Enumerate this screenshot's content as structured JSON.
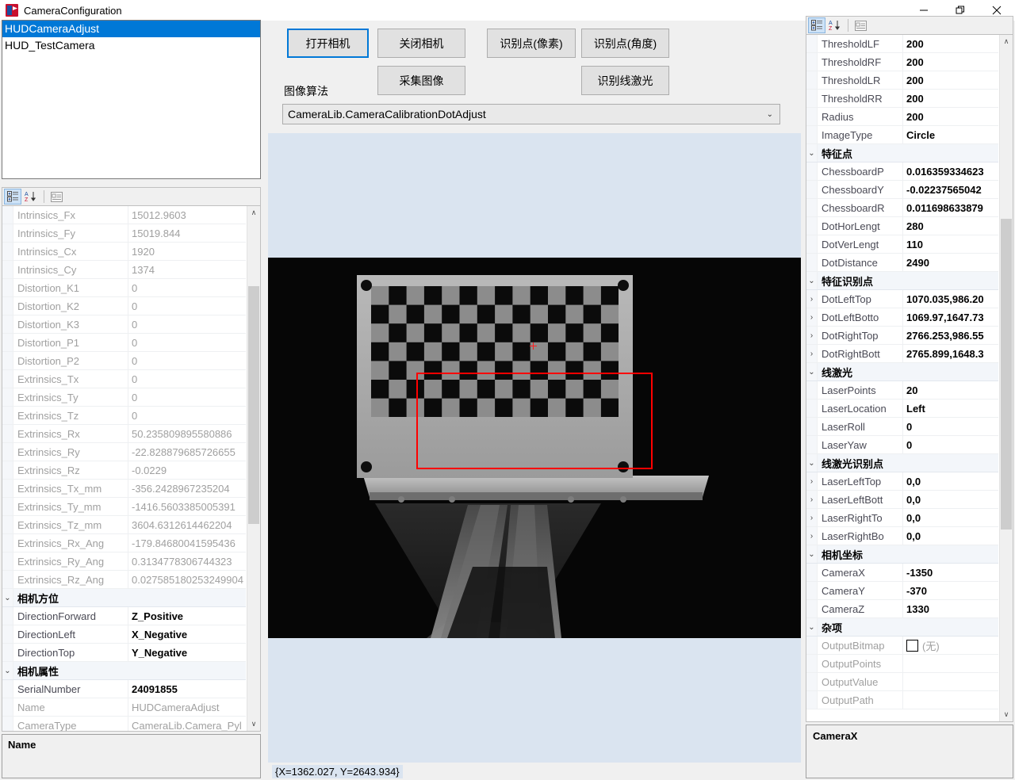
{
  "window": {
    "title": "CameraConfiguration",
    "icon": "app-icon",
    "minimize": "─",
    "maximize": "❐",
    "close": "✕"
  },
  "camera_list": {
    "items": [
      {
        "label": "HUDCameraAdjust",
        "selected": true
      },
      {
        "label": "HUD_TestCamera",
        "selected": false
      }
    ]
  },
  "toolbar": {
    "categorized_icon": "categorized-view-icon",
    "alphabetical_icon": "alphabetical-sort-icon",
    "property_pages_icon": "property-pages-icon"
  },
  "buttons": {
    "open_camera": "打开相机",
    "close_camera": "关闭相机",
    "detect_point_pixel": "识别点(像素)",
    "detect_point_angle": "识别点(角度)",
    "capture_image": "采集图像",
    "detect_line_laser": "识别线激光"
  },
  "algorithm": {
    "label": "图像算法",
    "selected": "CameraLib.CameraCalibrationDotAdjust",
    "arrow": "⌄"
  },
  "statusbar": {
    "coordinates": "{X=1362.027, Y=2643.934}"
  },
  "left_panel": {
    "description_title": "Name",
    "rows": [
      {
        "name": "Intrinsics_Fx",
        "value": "15012.9603",
        "style": "dim"
      },
      {
        "name": "Intrinsics_Fy",
        "value": "15019.844",
        "style": "dim"
      },
      {
        "name": "Intrinsics_Cx",
        "value": "1920",
        "style": "dim"
      },
      {
        "name": "Intrinsics_Cy",
        "value": "1374",
        "style": "dim"
      },
      {
        "name": "Distortion_K1",
        "value": "0",
        "style": "dim"
      },
      {
        "name": "Distortion_K2",
        "value": "0",
        "style": "dim"
      },
      {
        "name": "Distortion_K3",
        "value": "0",
        "style": "dim"
      },
      {
        "name": "Distortion_P1",
        "value": "0",
        "style": "dim"
      },
      {
        "name": "Distortion_P2",
        "value": "0",
        "style": "dim"
      },
      {
        "name": "Extrinsics_Tx",
        "value": "0",
        "style": "dim"
      },
      {
        "name": "Extrinsics_Ty",
        "value": "0",
        "style": "dim"
      },
      {
        "name": "Extrinsics_Tz",
        "value": "0",
        "style": "dim"
      },
      {
        "name": "Extrinsics_Rx",
        "value": "50.235809895580886",
        "style": "dim"
      },
      {
        "name": "Extrinsics_Ry",
        "value": "-22.828879685726655",
        "style": "dim"
      },
      {
        "name": "Extrinsics_Rz",
        "value": "-0.0229",
        "style": "dim"
      },
      {
        "name": "Extrinsics_Tx_mm",
        "value": "-356.2428967235204",
        "style": "dim"
      },
      {
        "name": "Extrinsics_Ty_mm",
        "value": "-1416.5603385005391",
        "style": "dim"
      },
      {
        "name": "Extrinsics_Tz_mm",
        "value": "3604.6312614462204",
        "style": "dim"
      },
      {
        "name": "Extrinsics_Rx_Ang",
        "value": "-179.84680041595436",
        "style": "dim"
      },
      {
        "name": "Extrinsics_Ry_Ang",
        "value": "0.3134778306744323",
        "style": "dim"
      },
      {
        "name": "Extrinsics_Rz_Ang",
        "value": "0.027585180253249904",
        "style": "dim"
      },
      {
        "name": "相机方位",
        "value": "",
        "style": "cat",
        "expander": "⌄"
      },
      {
        "name": "DirectionForward",
        "value": "Z_Positive",
        "style": "bold"
      },
      {
        "name": "DirectionLeft",
        "value": "X_Negative",
        "style": "bold"
      },
      {
        "name": "DirectionTop",
        "value": "Y_Negative",
        "style": "bold"
      },
      {
        "name": "相机属性",
        "value": "",
        "style": "cat",
        "expander": "⌄"
      },
      {
        "name": "SerialNumber",
        "value": "24091855",
        "style": "bold"
      },
      {
        "name": "Name",
        "value": "HUDCameraAdjust",
        "style": "dim"
      },
      {
        "name": "CameraType",
        "value": "CameraLib.Camera_Pyl",
        "style": "dim"
      }
    ]
  },
  "right_panel": {
    "description_title": "CameraX",
    "rows": [
      {
        "name": "ThresholdLF",
        "value": "200",
        "style": "bold"
      },
      {
        "name": "ThresholdRF",
        "value": "200",
        "style": "bold"
      },
      {
        "name": "ThresholdLR",
        "value": "200",
        "style": "bold"
      },
      {
        "name": "ThresholdRR",
        "value": "200",
        "style": "bold"
      },
      {
        "name": "Radius",
        "value": "200",
        "style": "bold"
      },
      {
        "name": "ImageType",
        "value": "Circle",
        "style": "bold"
      },
      {
        "name": "特征点",
        "value": "",
        "style": "cat",
        "expander": "⌄"
      },
      {
        "name": "ChessboardP",
        "value": "0.016359334623",
        "style": "bold"
      },
      {
        "name": "ChessboardY",
        "value": "-0.02237565042",
        "style": "bold"
      },
      {
        "name": "ChessboardR",
        "value": "0.011698633879",
        "style": "bold"
      },
      {
        "name": "DotHorLengt",
        "value": "280",
        "style": "bold"
      },
      {
        "name": "DotVerLengt",
        "value": "110",
        "style": "bold"
      },
      {
        "name": "DotDistance",
        "value": "2490",
        "style": "bold"
      },
      {
        "name": "特征识别点",
        "value": "",
        "style": "cat",
        "expander": "⌄"
      },
      {
        "name": "DotLeftTop",
        "value": "1070.035,986.20",
        "style": "bold",
        "expander": "›"
      },
      {
        "name": "DotLeftBotto",
        "value": "1069.97,1647.73",
        "style": "bold",
        "expander": "›"
      },
      {
        "name": "DotRightTop",
        "value": "2766.253,986.55",
        "style": "bold",
        "expander": "›"
      },
      {
        "name": "DotRightBott",
        "value": "2765.899,1648.3",
        "style": "bold",
        "expander": "›"
      },
      {
        "name": "线激光",
        "value": "",
        "style": "cat",
        "expander": "⌄"
      },
      {
        "name": "LaserPoints",
        "value": "20",
        "style": "bold"
      },
      {
        "name": "LaserLocation",
        "value": "Left",
        "style": "bold"
      },
      {
        "name": "LaserRoll",
        "value": "0",
        "style": "bold"
      },
      {
        "name": "LaserYaw",
        "value": "0",
        "style": "bold"
      },
      {
        "name": "线激光识别点",
        "value": "",
        "style": "cat",
        "expander": "⌄"
      },
      {
        "name": "LaserLeftTop",
        "value": "0,0",
        "style": "bold",
        "expander": "›"
      },
      {
        "name": "LaserLeftBott",
        "value": "0,0",
        "style": "bold",
        "expander": "›"
      },
      {
        "name": "LaserRightTo",
        "value": "0,0",
        "style": "bold",
        "expander": "›"
      },
      {
        "name": "LaserRightBo",
        "value": "0,0",
        "style": "bold",
        "expander": "›"
      },
      {
        "name": "相机坐标",
        "value": "",
        "style": "cat",
        "expander": "⌄"
      },
      {
        "name": "CameraX",
        "value": "-1350",
        "style": "bold"
      },
      {
        "name": "CameraY",
        "value": "-370",
        "style": "bold"
      },
      {
        "name": "CameraZ",
        "value": "1330",
        "style": "bold"
      },
      {
        "name": "杂项",
        "value": "",
        "style": "cat",
        "expander": "⌄"
      },
      {
        "name": "OutputBitmap",
        "value": "(无)",
        "style": "dim",
        "checkbox": true
      },
      {
        "name": "OutputPoints",
        "value": "",
        "style": "dim"
      },
      {
        "name": "OutputValue",
        "value": "",
        "style": "dim"
      },
      {
        "name": "OutputPath",
        "value": "",
        "style": "dim"
      }
    ]
  },
  "colors": {
    "accent": "#0078d7",
    "roi": "#ff0000",
    "viewer_bg": "#dae4f0",
    "image_bg": "#060606"
  }
}
